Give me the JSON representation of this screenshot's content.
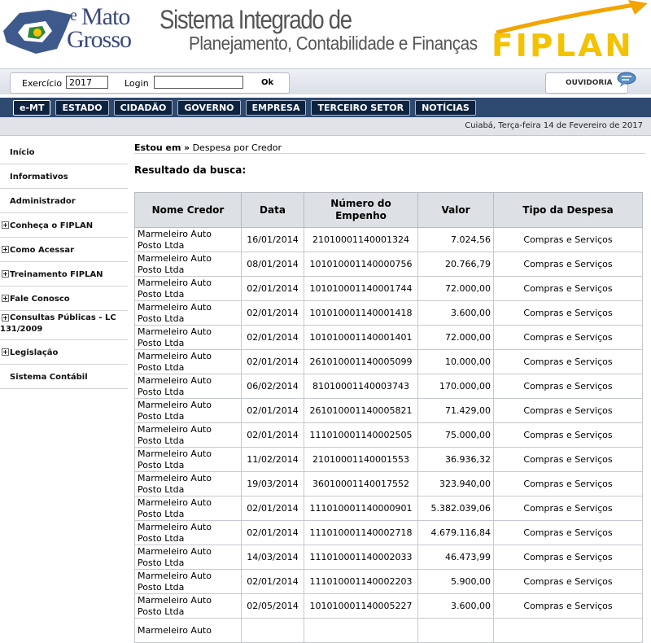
{
  "header": {
    "logo_e": "e",
    "logo_line1": "Mato",
    "logo_line2": "Grosso",
    "title_line1": "Sistema Integrado de",
    "title_line2": "Planejamento, Contabilidade e Finanças",
    "brand": "FIPLAN",
    "brand_color": "#f3c200"
  },
  "login": {
    "exercicio_label": "Exercício",
    "exercicio_value": "2017",
    "login_label": "Login",
    "login_value": "",
    "ok_label": "Ok",
    "ouvidoria_label": "OUVIDORIA"
  },
  "nav": {
    "tabs": [
      "e-MT",
      "ESTADO",
      "CIDADÃO",
      "GOVERNO",
      "EMPRESA",
      "TERCEIRO SETOR",
      "NOTÍCIAS"
    ]
  },
  "date_text": "Cuiabá, Terça-feira 14 de Fevereiro de 2017",
  "sidebar": {
    "items": [
      {
        "label": "Início"
      },
      {
        "label": "Informativos"
      },
      {
        "label": "Administrador"
      },
      {
        "label": "Conheça o FIPLAN"
      },
      {
        "label": "Como Acessar"
      },
      {
        "label": "Treinamento FIPLAN"
      },
      {
        "label": "Fale Conosco"
      },
      {
        "label": "Consultas Públicas - LC",
        "label2": "131/2009"
      },
      {
        "label": "Legislação"
      },
      {
        "label": "Sistema Contábil"
      }
    ]
  },
  "breadcrumb": {
    "prefix": "Estou em",
    "separator": "»",
    "current": "Despesa por Credor"
  },
  "result_title": "Resultado da busca:",
  "table": {
    "headers": [
      "Nome Credor",
      "Data",
      "Número do Empenho",
      "Valor",
      "Tipo da Despesa"
    ],
    "rows": [
      {
        "credor": "Marmeleiro Auto Posto Ltda",
        "data": "16/01/2014",
        "empenho": "21010001140001324",
        "valor": "7.024,56",
        "tipo": "Compras e Serviços"
      },
      {
        "credor": "Marmeleiro Auto Posto Ltda",
        "data": "08/01/2014",
        "empenho": "101010001140000756",
        "valor": "20.766,79",
        "tipo": "Compras e Serviços"
      },
      {
        "credor": "Marmeleiro Auto Posto Ltda",
        "data": "02/01/2014",
        "empenho": "101010001140001744",
        "valor": "72.000,00",
        "tipo": "Compras e Serviços"
      },
      {
        "credor": "Marmeleiro Auto Posto Ltda",
        "data": "02/01/2014",
        "empenho": "101010001140001418",
        "valor": "3.600,00",
        "tipo": "Compras e Serviços"
      },
      {
        "credor": "Marmeleiro Auto Posto Ltda",
        "data": "02/01/2014",
        "empenho": "101010001140001401",
        "valor": "72.000,00",
        "tipo": "Compras e Serviços"
      },
      {
        "credor": "Marmeleiro Auto Posto Ltda",
        "data": "02/01/2014",
        "empenho": "261010001140005099",
        "valor": "10.000,00",
        "tipo": "Compras e Serviços"
      },
      {
        "credor": "Marmeleiro Auto Posto Ltda",
        "data": "06/02/2014",
        "empenho": "81010001140003743",
        "valor": "170.000,00",
        "tipo": "Compras e Serviços"
      },
      {
        "credor": "Marmeleiro Auto Posto Ltda",
        "data": "02/01/2014",
        "empenho": "261010001140005821",
        "valor": "71.429,00",
        "tipo": "Compras e Serviços"
      },
      {
        "credor": "Marmeleiro Auto Posto Ltda",
        "data": "02/01/2014",
        "empenho": "111010001140002505",
        "valor": "75.000,00",
        "tipo": "Compras e Serviços"
      },
      {
        "credor": "Marmeleiro Auto Posto Ltda",
        "data": "11/02/2014",
        "empenho": "21010001140001553",
        "valor": "36.936,32",
        "tipo": "Compras e Serviços"
      },
      {
        "credor": "Marmeleiro Auto Posto Ltda",
        "data": "19/03/2014",
        "empenho": "36010001140017552",
        "valor": "323.940,00",
        "tipo": "Compras e Serviços"
      },
      {
        "credor": "Marmeleiro Auto Posto Ltda",
        "data": "02/01/2014",
        "empenho": "111010001140000901",
        "valor": "5.382.039,06",
        "tipo": "Compras e Serviços"
      },
      {
        "credor": "Marmeleiro Auto Posto Ltda",
        "data": "02/01/2014",
        "empenho": "111010001140002718",
        "valor": "4.679.116,84",
        "tipo": "Compras e Serviços"
      },
      {
        "credor": "Marmeleiro Auto Posto Ltda",
        "data": "14/03/2014",
        "empenho": "111010001140002033",
        "valor": "46.473,99",
        "tipo": "Compras e Serviços"
      },
      {
        "credor": "Marmeleiro Auto Posto Ltda",
        "data": "02/01/2014",
        "empenho": "111010001140002203",
        "valor": "5.900,00",
        "tipo": "Compras e Serviços"
      },
      {
        "credor": "Marmeleiro Auto Posto Ltda",
        "data": "02/05/2014",
        "empenho": "101010001140005227",
        "valor": "3.600,00",
        "tipo": "Compras e Serviços"
      },
      {
        "credor": "Marmeleiro Auto",
        "data": "",
        "empenho": "",
        "valor": "",
        "tipo": ""
      }
    ]
  }
}
